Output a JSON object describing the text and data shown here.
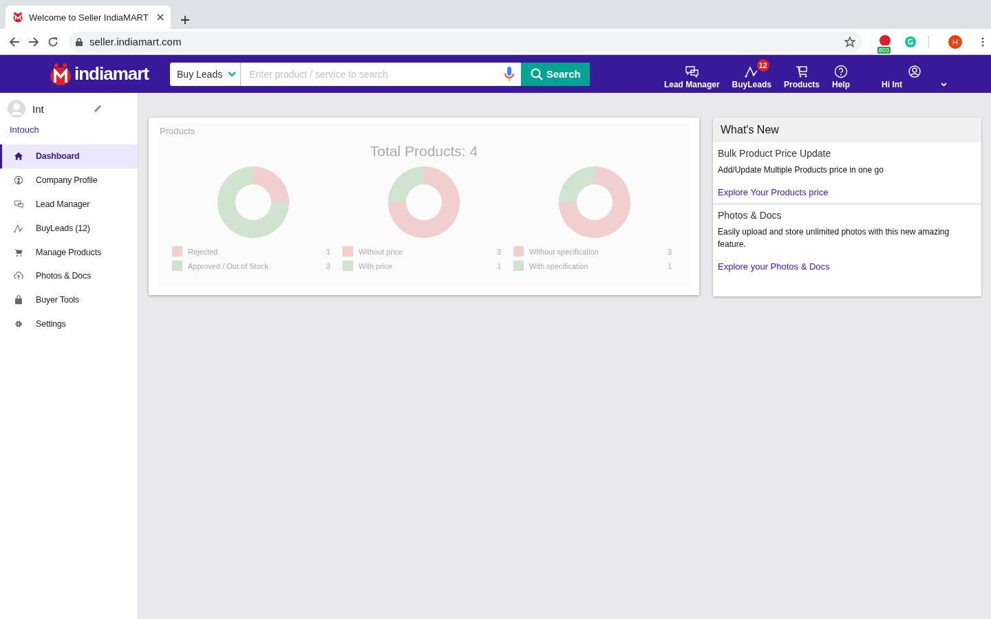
{
  "browser": {
    "tab_title": "Welcome to Seller IndiaMART",
    "url": "seller.indiamart.com",
    "extension_badge": "803",
    "profile_initial": "H"
  },
  "header": {
    "logo": "indiamart",
    "search_scope": "Buy Leads",
    "search_placeholder": "Enter product / service to search",
    "search_button": "Search",
    "nav": [
      {
        "kind": "leads",
        "label": "Lead Manager"
      },
      {
        "kind": "buyleads",
        "label": "BuyLeads",
        "badge": "12"
      },
      {
        "kind": "products",
        "label": "Products"
      },
      {
        "kind": "help",
        "label": "Help"
      },
      {
        "kind": "user",
        "label": "Hi Int"
      }
    ]
  },
  "sidebar": {
    "user_name": "Int",
    "company": "Intouch",
    "items": [
      {
        "kind": "home",
        "label": "Dashboard",
        "selected": true
      },
      {
        "kind": "profile",
        "label": "Company Profile",
        "selected": false
      },
      {
        "kind": "leads",
        "label": "Lead Manager",
        "selected": false
      },
      {
        "kind": "buyleads",
        "label": "BuyLeads (12)",
        "selected": false
      },
      {
        "kind": "cart",
        "label": "Manage Products",
        "selected": false
      },
      {
        "kind": "upload",
        "label": "Photos & Docs",
        "selected": false
      },
      {
        "kind": "bag",
        "label": "Buyer Tools",
        "selected": false
      },
      {
        "kind": "gear",
        "label": "Settings",
        "selected": false
      }
    ]
  },
  "products_card": {
    "title": "Products",
    "total": "Total Products: 4",
    "donuts": [
      {
        "legend": [
          {
            "count": "1",
            "color": "#f2cfcf"
          },
          {
            "count": "3",
            "color": "#cfe3cf"
          }
        ],
        "chart_data": {
          "type": "donut",
          "categories": [
            "Rejected",
            "Approved / Out of Stock"
          ],
          "values": [
            25,
            75
          ],
          "legend": "bottom"
        }
      },
      {
        "legend": [
          {
            "count": "3",
            "color": "#f2cfcf"
          },
          {
            "count": "1",
            "color": "#cfe3cf"
          }
        ],
        "chart_data": {
          "type": "donut",
          "categories": [
            "Without price",
            "With price"
          ],
          "values": [
            75,
            25
          ],
          "legend": "bottom"
        }
      },
      {
        "legend": [
          {
            "count": "3",
            "color": "#f2cfcf"
          },
          {
            "count": "1",
            "color": "#cfe3cf"
          }
        ],
        "chart_data": {
          "type": "donut",
          "categories": [
            "Without specification",
            "With specification"
          ],
          "values": [
            75,
            25
          ],
          "legend": "bottom"
        }
      }
    ]
  },
  "whats_new": {
    "title": "What's New",
    "items": [
      {
        "heading": "Bulk Product Price Update",
        "text": "Add/Update Multiple Products price in one go",
        "link": "Explore Your Products price"
      },
      {
        "heading": "Photos & Docs",
        "text": "Easily upload and store unlimited photos with this new amazing feature.",
        "link": "Explore your Photos & Docs"
      }
    ]
  }
}
